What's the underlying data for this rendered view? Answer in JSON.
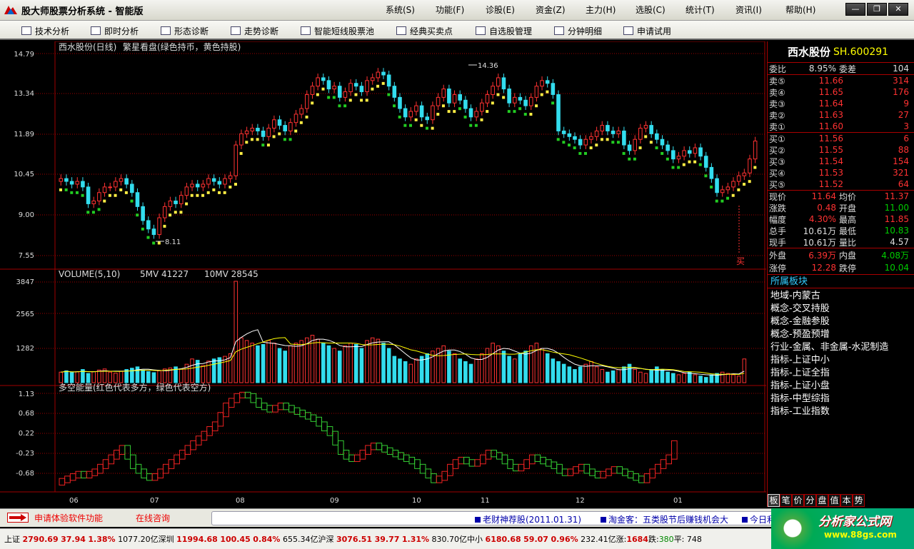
{
  "app": {
    "title": "股大师股票分析系统 - 智能版",
    "menu": [
      "系统(S)",
      "功能(F)",
      "诊股(E)",
      "资金(Z)",
      "主力(H)",
      "选股(C)",
      "统计(T)",
      "资讯(I)",
      "帮助(H)"
    ],
    "window_buttons": [
      "—",
      "❐",
      "✕"
    ]
  },
  "toolbar": [
    {
      "label": "技术分析",
      "icon": "chart-analysis-icon"
    },
    {
      "label": "即时分析",
      "icon": "realtime-line-icon"
    },
    {
      "label": "形态诊断",
      "icon": "pattern-icon"
    },
    {
      "label": "走势诊断",
      "icon": "trend-icon"
    },
    {
      "label": "智能短线股票池",
      "icon": "pool-icon"
    },
    {
      "label": "经典买卖点",
      "icon": "trade-point-icon"
    },
    {
      "label": "自选股管理",
      "icon": "watchlist-icon"
    },
    {
      "label": "分钟明细",
      "icon": "minute-detail-icon"
    },
    {
      "label": "申请试用",
      "icon": "vip-icon"
    }
  ],
  "kline": {
    "title": "西水股份(日线)",
    "indicator": "繁星看盘(绿色持币，黄色持股)",
    "y_ticks": [
      "14.79",
      "13.34",
      "11.89",
      "10.45",
      "9.00",
      "7.55"
    ],
    "high_label": "14.36",
    "low_label": "8.11",
    "buy_marker": "买"
  },
  "volume": {
    "title": "VOLUME(5,10)",
    "ma5": "5MV 41227",
    "ma10": "10MV 28545",
    "y_ticks": [
      "3847",
      "2565",
      "1282"
    ]
  },
  "energy": {
    "title": "多空能量(红色代表多方，绿色代表空方)",
    "y_ticks": [
      "1.13",
      "0.68",
      "0.22",
      "-0.23",
      "-0.68"
    ]
  },
  "x_ticks": [
    "06",
    "07",
    "08",
    "09",
    "10",
    "11",
    "12",
    "01"
  ],
  "chart_data": {
    "type": "candlestick",
    "y_range_price": [
      7.55,
      14.79
    ],
    "y_range_volume": [
      0,
      3847
    ],
    "y_range_energy": [
      -0.9,
      1.13
    ],
    "close": [
      10.3,
      10.2,
      10.1,
      10.2,
      10.0,
      9.4,
      9.5,
      9.8,
      10.0,
      10.0,
      10.2,
      10.3,
      10.1,
      9.8,
      9.3,
      8.8,
      8.5,
      8.3,
      8.9,
      9.3,
      9.5,
      9.4,
      9.7,
      10.0,
      10.1,
      10.0,
      10.1,
      10.3,
      10.2,
      10.1,
      10.3,
      10.4,
      11.5,
      11.9,
      12.0,
      12.1,
      12.0,
      11.8,
      12.1,
      12.4,
      12.2,
      12.0,
      12.3,
      12.6,
      12.8,
      13.3,
      13.6,
      13.9,
      13.8,
      13.5,
      13.6,
      13.2,
      13.4,
      13.7,
      13.6,
      13.4,
      13.8,
      13.9,
      14.1,
      14.0,
      13.6,
      13.2,
      12.8,
      12.5,
      12.7,
      12.9,
      12.5,
      12.4,
      12.9,
      13.2,
      13.5,
      13.0,
      13.3,
      13.1,
      12.8,
      12.5,
      12.7,
      13.0,
      13.3,
      13.6,
      13.9,
      13.5,
      13.0,
      13.2,
      13.1,
      12.9,
      13.2,
      13.6,
      13.8,
      13.7,
      13.3,
      12.0,
      11.9,
      11.8,
      11.7,
      11.5,
      11.7,
      11.8,
      12.0,
      12.2,
      12.0,
      11.9,
      12.0,
      11.5,
      11.3,
      11.7,
      12.1,
      12.2,
      11.9,
      11.7,
      11.5,
      11.3,
      11.0,
      11.1,
      11.3,
      11.2,
      11.4,
      11.1,
      10.7,
      10.3,
      9.8,
      9.9,
      10.0,
      10.2,
      10.4,
      10.5,
      11.0,
      11.64
    ],
    "volume": [
      400,
      450,
      380,
      420,
      500,
      350,
      420,
      480,
      520,
      400,
      360,
      430,
      500,
      550,
      600,
      480,
      420,
      380,
      450,
      520,
      560,
      600,
      520,
      700,
      900,
      850,
      650,
      820,
      900,
      950,
      1000,
      1100,
      3847,
      1700,
      1600,
      1500,
      1400,
      1450,
      1600,
      1500,
      1300,
      1200,
      1400,
      1500,
      1600,
      1700,
      1800,
      1650,
      1500,
      1400,
      1300,
      1200,
      1400,
      1500,
      1450,
      1300,
      1600,
      1700,
      1650,
      1500,
      1300,
      1000,
      900,
      800,
      700,
      900,
      1000,
      1100,
      1200,
      1300,
      1400,
      1200,
      1100,
      900,
      800,
      700,
      900,
      1100,
      1300,
      1500,
      1400,
      1200,
      1000,
      900,
      1100,
      1200,
      1400,
      1500,
      1300,
      1100,
      900,
      800,
      700,
      600,
      500,
      600,
      700,
      800,
      600,
      500,
      400,
      450,
      500,
      600,
      700,
      500,
      400,
      350,
      500,
      600,
      500,
      400,
      350,
      300,
      350,
      400,
      300,
      250,
      200,
      300,
      350,
      400,
      350,
      300,
      250,
      900
    ],
    "energy": [
      -0.7,
      -0.65,
      -0.6,
      -0.55,
      -0.6,
      -0.55,
      -0.5,
      -0.4,
      -0.3,
      -0.2,
      -0.1,
      0.0,
      -0.2,
      -0.4,
      -0.5,
      -0.6,
      -0.65,
      -0.6,
      -0.5,
      -0.4,
      -0.3,
      -0.2,
      -0.1,
      0.0,
      0.1,
      0.2,
      0.3,
      0.4,
      0.5,
      0.7,
      0.9,
      1.0,
      1.1,
      1.13,
      1.1,
      1.0,
      0.9,
      0.85,
      0.8,
      0.85,
      0.9,
      0.85,
      0.8,
      0.75,
      0.7,
      0.65,
      0.6,
      0.5,
      0.4,
      0.3,
      0.1,
      -0.1,
      -0.2,
      -0.25,
      -0.2,
      -0.1,
      0.0,
      0.05,
      0.0,
      -0.05,
      -0.1,
      -0.15,
      -0.2,
      -0.25,
      -0.3,
      -0.4,
      -0.5,
      -0.6,
      -0.7,
      -0.65,
      -0.55,
      -0.4,
      -0.3,
      -0.25,
      -0.3,
      -0.35,
      -0.3,
      -0.2,
      -0.1,
      -0.15,
      -0.2,
      -0.3,
      -0.4,
      -0.45,
      -0.4,
      -0.3,
      -0.2,
      -0.25,
      -0.3,
      -0.35,
      -0.4,
      -0.5,
      -0.55,
      -0.5,
      -0.45,
      -0.4,
      -0.5,
      -0.55,
      -0.6,
      -0.55,
      -0.5,
      -0.45,
      -0.5,
      -0.55,
      -0.6,
      -0.65,
      -0.7,
      -0.6,
      -0.5,
      -0.4,
      -0.3,
      -0.2,
      0.1
    ]
  },
  "quote": {
    "name": "西水股份",
    "code": "SH.600291",
    "weibi_label": "委比",
    "weibi": "8.95%",
    "weicha_label": "委差",
    "weicha": "104",
    "asks": [
      {
        "label": "卖⑤",
        "price": "11.66",
        "vol": "314"
      },
      {
        "label": "卖④",
        "price": "11.65",
        "vol": "176"
      },
      {
        "label": "卖③",
        "price": "11.64",
        "vol": "9"
      },
      {
        "label": "卖②",
        "price": "11.63",
        "vol": "27"
      },
      {
        "label": "卖①",
        "price": "11.60",
        "vol": "3"
      }
    ],
    "bids": [
      {
        "label": "买①",
        "price": "11.56",
        "vol": "6"
      },
      {
        "label": "买②",
        "price": "11.55",
        "vol": "88"
      },
      {
        "label": "买③",
        "price": "11.54",
        "vol": "154"
      },
      {
        "label": "买④",
        "price": "11.53",
        "vol": "321"
      },
      {
        "label": "买⑤",
        "price": "11.52",
        "vol": "64"
      }
    ],
    "stats": [
      {
        "l1": "现价",
        "v1": "11.64",
        "c1": "red",
        "l2": "均价",
        "v2": "11.37",
        "c2": "red"
      },
      {
        "l1": "涨跌",
        "v1": "0.48",
        "c1": "red",
        "l2": "开盘",
        "v2": "11.00",
        "c2": "green"
      },
      {
        "l1": "幅度",
        "v1": "4.30%",
        "c1": "red",
        "l2": "最高",
        "v2": "11.85",
        "c2": "red"
      },
      {
        "l1": "总手",
        "v1": "10.61万",
        "c1": "white",
        "l2": "最低",
        "v2": "10.83",
        "c2": "green"
      },
      {
        "l1": "现手",
        "v1": "10.61万",
        "c1": "white",
        "l2": "量比",
        "v2": "4.57",
        "c2": "white"
      }
    ],
    "outer_label": "外盘",
    "outer": "6.39万",
    "inner_label": "内盘",
    "inner": "4.08万",
    "limitup_label": "涨停",
    "limitup": "12.28",
    "limitdown_label": "跌停",
    "limitdown": "10.04"
  },
  "sectors": {
    "title": "所属板块",
    "items": [
      "地域-内蒙古",
      "概念-交叉持股",
      "概念-金融参股",
      "概念-预盈预增",
      "行业-金属、非金属-水泥制造",
      "指标-上证中小",
      "指标-上证全指",
      "指标-上证小盘",
      "指标-中型综指",
      "指标-工业指数"
    ]
  },
  "side_tabs": [
    "板",
    "笔",
    "价",
    "分",
    "盘",
    "值",
    "本",
    "势"
  ],
  "messages": {
    "link1": "申请体验软件功能",
    "link2": "在线咨询",
    "ticker": [
      "老财神荐股(2011.01.31)",
      "淘金客：五类股节后赚钱机会大",
      "今日利"
    ]
  },
  "brand": {
    "name": "分析家公式网",
    "url": "www.88gs.com"
  },
  "status": {
    "sh_label": "上证",
    "sh_idx": "2790.69",
    "sh_chg": "37.94",
    "sh_pct": "1.38%",
    "sh_amt": "1077.20亿",
    "sz_label": "深圳",
    "sz_idx": "11994.68",
    "sz_chg": "100.45",
    "sz_pct": "0.84%",
    "sz_amt": "655.34亿",
    "hs_label": "沪深",
    "hs_idx": "3076.51",
    "hs_chg": "39.77",
    "hs_pct": "1.31%",
    "hs_amt": "830.70亿",
    "zx_label": "中小",
    "zx_idx": "6180.68",
    "zx_chg": "59.07",
    "zx_pct": "0.96%",
    "zx_amt": "232.41亿",
    "up_label": "涨:",
    "up": "1684",
    "down_label": "跌:",
    "down": "380",
    "flat_label": "平:",
    "flat": "748"
  },
  "colors": {
    "up": "#ff3232",
    "down": "#33ddee",
    "star_hold": "#ffee44",
    "star_cash": "#22cc22",
    "grid": "#a00000"
  }
}
